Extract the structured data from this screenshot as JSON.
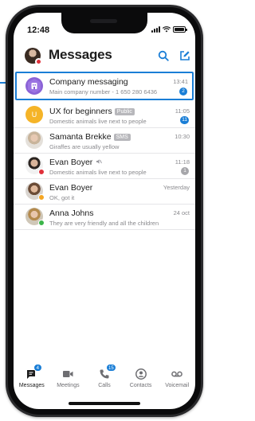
{
  "status_bar": {
    "time": "12:48"
  },
  "header": {
    "title": "Messages"
  },
  "conversations": [
    {
      "name": "Company messaging",
      "tag": "",
      "preview": "Main company number - 1 650 280 6436",
      "time": "13:41",
      "badge": "2",
      "highlighted": true
    },
    {
      "name": "UX for beginners",
      "tag": "Public",
      "preview": "Domestic animals live next to people",
      "time": "11:05",
      "badge": "11"
    },
    {
      "name": "Samanta Brekke",
      "tag": "SMS",
      "preview": "Giraffes are usually yellow",
      "time": "10:30",
      "badge": ""
    },
    {
      "name": "Evan Boyer",
      "tag": "",
      "preview": "Domestic animals live next to people",
      "time": "11:18",
      "badge": "1",
      "muted": true
    },
    {
      "name": "Evan Boyer",
      "tag": "",
      "preview": "OK, got it",
      "time": "Yesterday",
      "badge": ""
    },
    {
      "name": "Anna Johns",
      "tag": "",
      "preview": "They are very friendly and all the children",
      "time": "24 oct",
      "badge": ""
    }
  ],
  "tabs": [
    {
      "label": "Messages",
      "badge": "4",
      "icon": "chat-icon",
      "active": true
    },
    {
      "label": "Meetings",
      "badge": "",
      "icon": "video-icon"
    },
    {
      "label": "Calls",
      "badge": "15",
      "icon": "phone-icon"
    },
    {
      "label": "Contacts",
      "badge": "",
      "icon": "contact-icon"
    },
    {
      "label": "Voicemail",
      "badge": "",
      "icon": "voicemail-icon"
    }
  ],
  "colors": {
    "accent": "#1a7ed6",
    "company_avatar": "#8b63d6",
    "ux_avatar": "#f5b428",
    "presence_busy": "#e0303a",
    "presence_away": "#f5a623",
    "presence_online": "#3bb54a"
  },
  "icons": {
    "search": "search-icon",
    "compose": "compose-icon",
    "mute": "mute-icon"
  }
}
